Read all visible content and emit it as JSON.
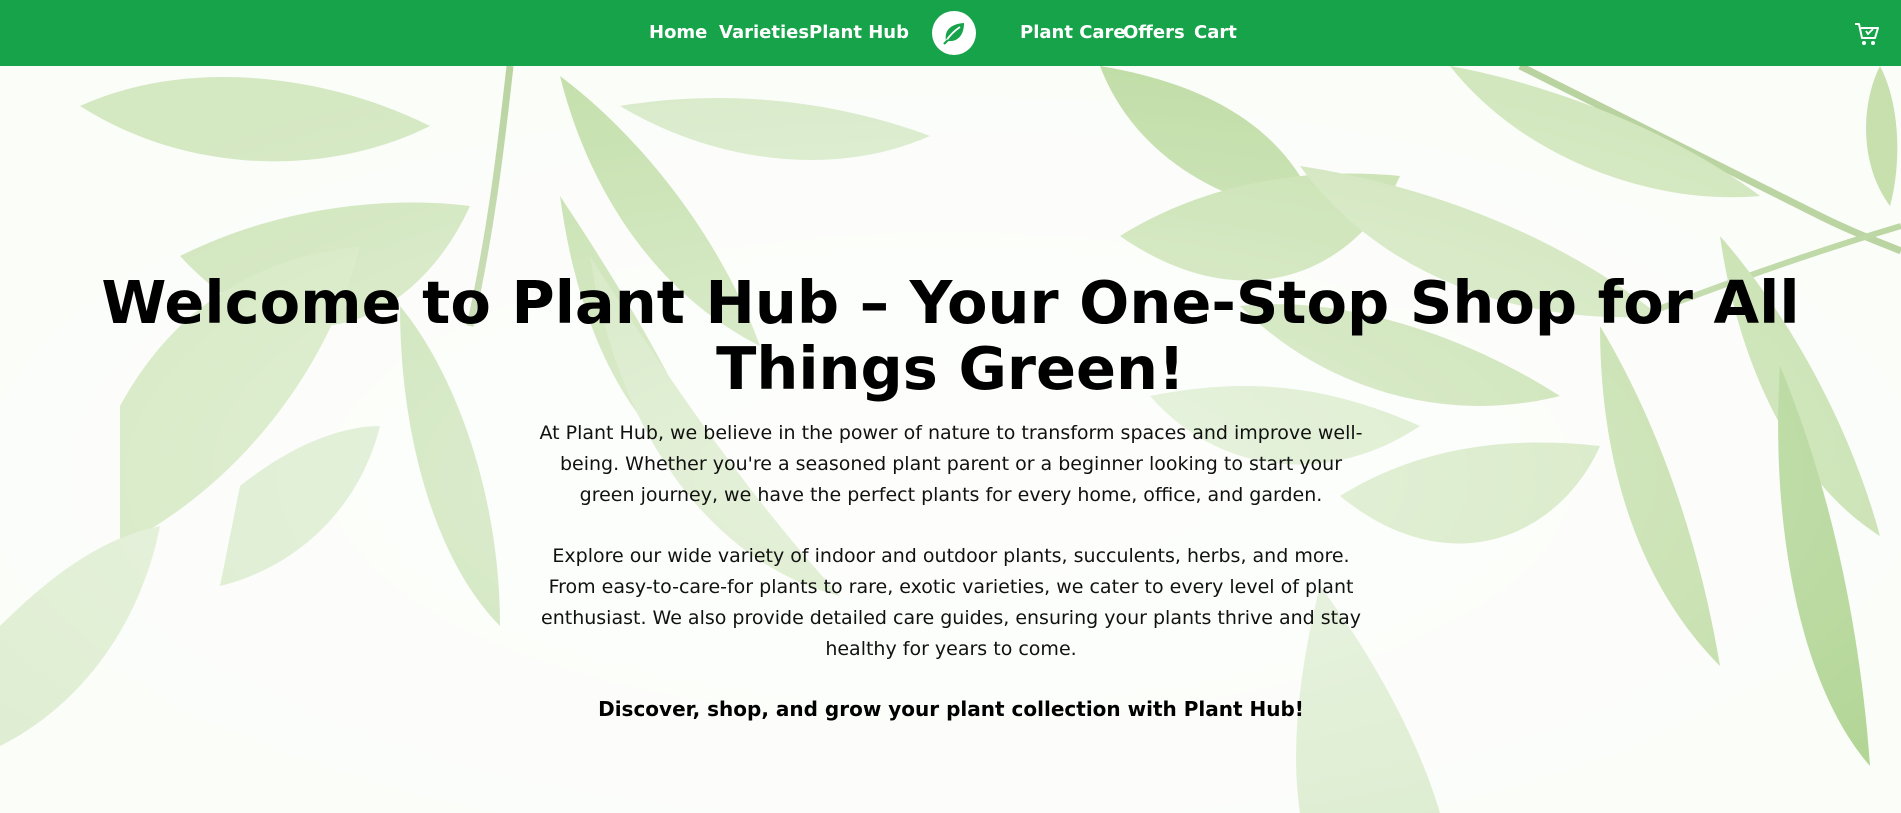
{
  "nav": {
    "links_left": [
      "Home",
      "Varieties",
      "Plant Hub"
    ],
    "links_right": [
      "Plant Care",
      "Offers",
      "Cart"
    ],
    "logo_icon": "leaf-icon",
    "cart_icon": "shopping-cart-icon"
  },
  "hero": {
    "title": "Welcome to Plant Hub – Your One-Stop Shop for All Things Green!",
    "paragraph1": "At Plant Hub, we believe in the power of nature to transform spaces and improve well-being. Whether you're a seasoned plant parent or a beginner looking to start your green journey, we have the perfect plants for every home, office, and garden.",
    "paragraph2": "Explore our wide variety of indoor and outdoor plants, succulents, herbs, and more. From easy-to-care-for plants to rare, exotic varieties, we cater to every level of plant enthusiast. We also provide detailed care guides, ensuring your plants thrive and stay healthy for years to come.",
    "tagline": "Discover, shop, and grow your plant collection with Plant Hub!"
  },
  "colors": {
    "nav_bg": "#16a34a",
    "nav_text": "#ffffff",
    "leaf_light": "#d8ecc8",
    "leaf_mid": "#b7d99c"
  }
}
